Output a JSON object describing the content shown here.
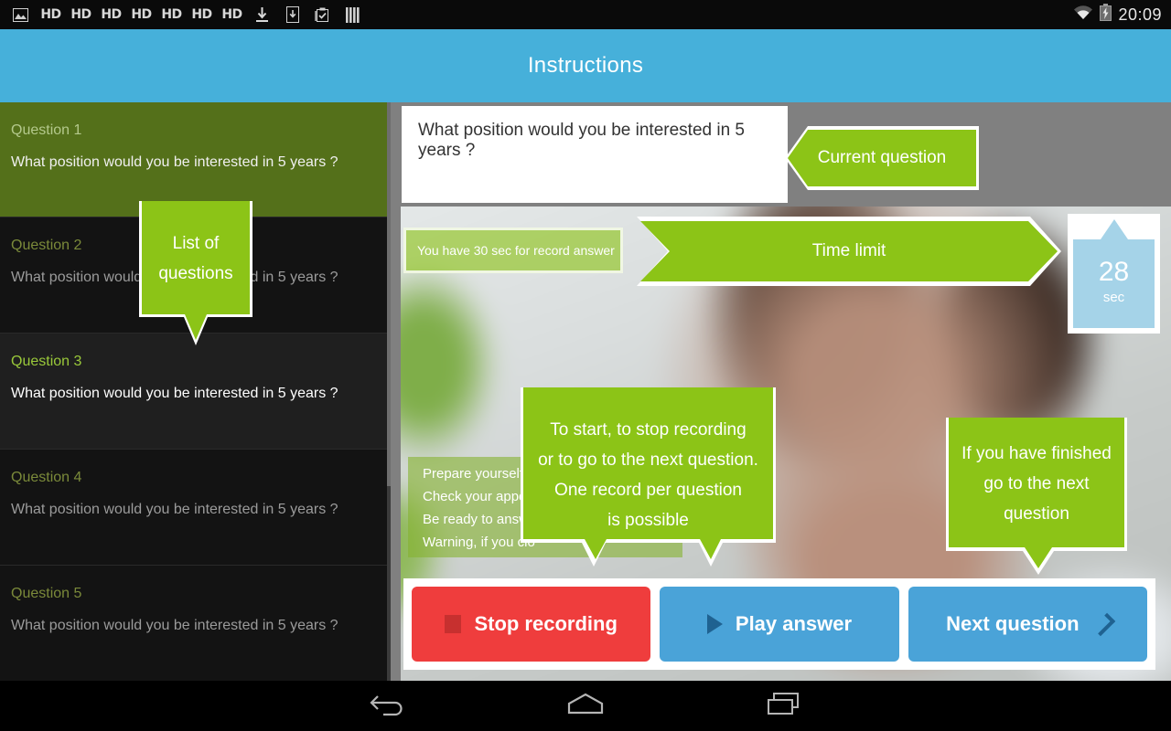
{
  "statusbar": {
    "icons": [
      "image-icon",
      "hd-icon",
      "hd-icon",
      "hd-icon",
      "hd-icon",
      "hd-icon",
      "hd-icon",
      "hd-icon",
      "download-icon",
      "save-to-device-icon",
      "clipboard-check-icon",
      "bars-icon"
    ],
    "hd_label": "HD",
    "wifi_icon": "wifi-icon",
    "battery_icon": "battery-charging-icon",
    "clock": "20:09"
  },
  "header": {
    "title": "Instructions"
  },
  "sidebar": {
    "questions": [
      {
        "number": "Question 1",
        "text": "What position would you be interested in 5 years ?",
        "state": "first"
      },
      {
        "number": "Question 2",
        "text": "What position would you be interested in 5 years ?",
        "state": "normal"
      },
      {
        "number": "Question 3",
        "text": "What position would you be interested in 5 years ?",
        "state": "active"
      },
      {
        "number": "Question 4",
        "text": "What position would you be interested in 5 years ?",
        "state": "normal"
      },
      {
        "number": "Question 5",
        "text": "What position would you be interested in 5 years ?",
        "state": "normal"
      }
    ],
    "callout": {
      "line1": "List of",
      "line2": "questions"
    }
  },
  "main": {
    "current_question": "What position would you be interested in 5 years ?",
    "current_question_callout": "Current question",
    "time_note": "You have 30 sec for record answer",
    "time_limit_callout": "Time limit",
    "timer": {
      "value": "28",
      "unit": "sec"
    },
    "tips": [
      "Prepare yourself fo",
      "Check your appeara",
      "Be ready to answer",
      "Warning, if you clo"
    ],
    "center_callout": {
      "line1": "To start, to stop recording",
      "line2": "or to go to the next question.",
      "line3": "One record per question",
      "line4": "is possible"
    },
    "right_callout": {
      "line1": "If you have finished",
      "line2": "go to the next",
      "line3": "question"
    },
    "buttons": {
      "stop": "Stop recording",
      "play": "Play answer",
      "next": "Next question"
    }
  },
  "navbar": {
    "back": "back-icon",
    "home": "home-icon",
    "recents": "recent-apps-icon"
  },
  "colors": {
    "accent_green": "#8cc417",
    "olive": "#54701a",
    "header_blue": "#46b0da",
    "button_blue": "#4aa3d8",
    "button_red": "#ef3d3d",
    "timer_blue": "#a5d3e8"
  }
}
